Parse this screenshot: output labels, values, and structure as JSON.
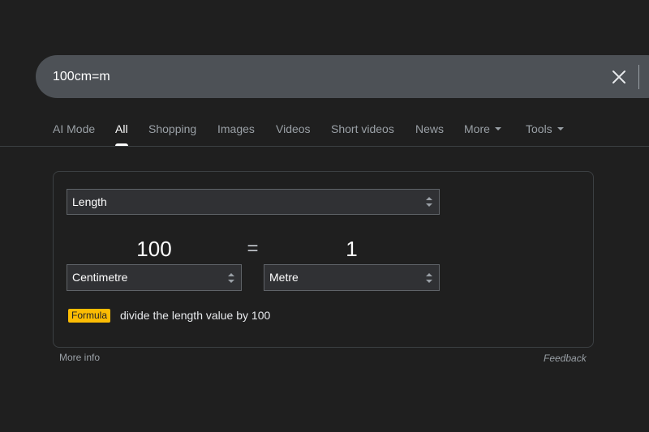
{
  "search": {
    "query": "100cm=m"
  },
  "tabs": [
    {
      "label": "AI Mode",
      "active": false
    },
    {
      "label": "All",
      "active": true
    },
    {
      "label": "Shopping",
      "active": false
    },
    {
      "label": "Images",
      "active": false
    },
    {
      "label": "Videos",
      "active": false
    },
    {
      "label": "Short videos",
      "active": false
    },
    {
      "label": "News",
      "active": false
    },
    {
      "label": "More",
      "active": false,
      "dropdown": true
    },
    {
      "label": "Tools",
      "active": false,
      "dropdown": true
    }
  ],
  "converter": {
    "quantity": "Length",
    "from_value": "100",
    "from_unit": "Centimetre",
    "equals": "=",
    "to_value": "1",
    "to_unit": "Metre",
    "formula_label": "Formula",
    "formula_text": "divide the length value by 100"
  },
  "footer": {
    "more_info": "More info",
    "feedback": "Feedback"
  },
  "colors": {
    "background": "#1f1f1f",
    "search_bar": "#4d5156",
    "formula_badge": "#fbbc04"
  },
  "icons": {
    "clear": "close-icon",
    "selector": "updown-arrows-icon",
    "dropdown": "caret-down-icon"
  }
}
